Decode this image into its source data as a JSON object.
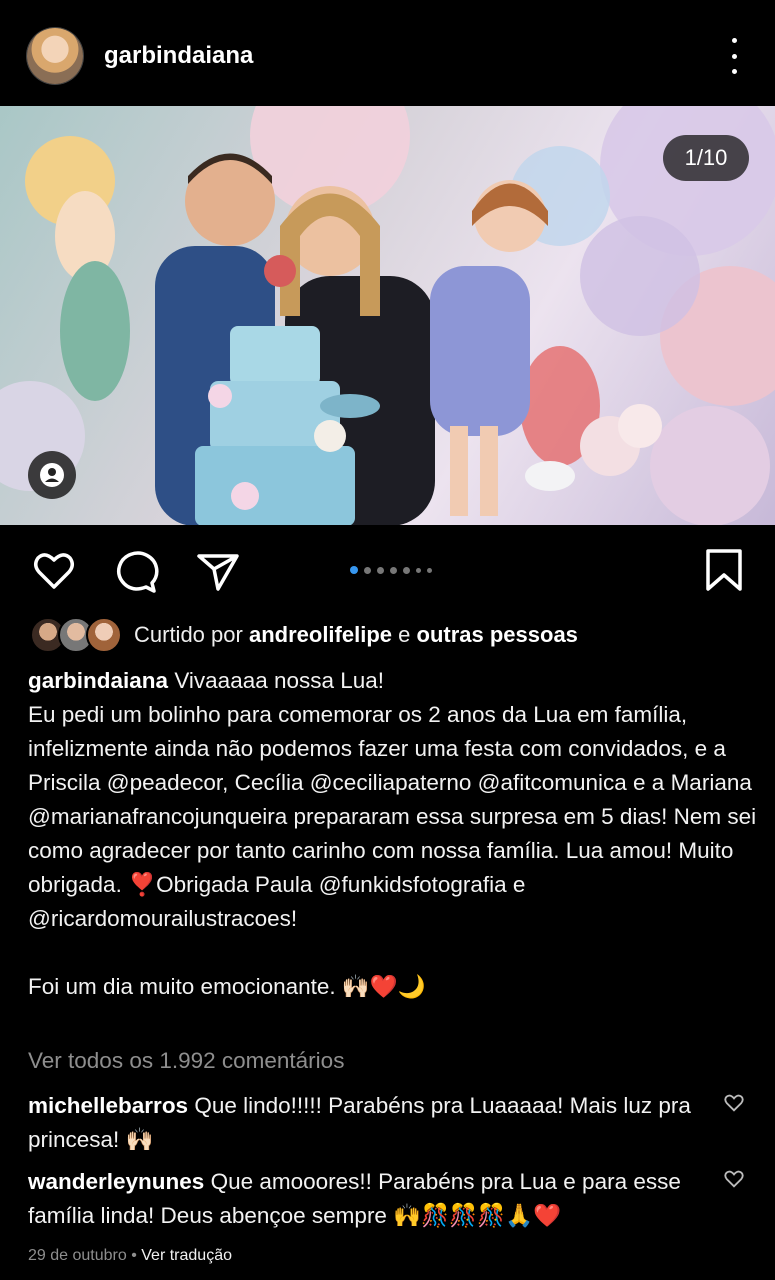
{
  "post": {
    "username": "garbindaiana",
    "counter": "1/10",
    "liked_by_prefix": "Curtido por",
    "liked_by_user": "andreolifelipe",
    "liked_by_connector": "e",
    "liked_by_others": "outras pessoas",
    "caption_user": "garbindaiana",
    "caption_text": "Vivaaaaa nossa Lua!\nEu pedi um bolinho para comemorar os 2 anos da Lua em família, infelizmente ainda não podemos fazer uma festa com convidados, e a Priscila @peadecor, Cecília @ceciliapaterno @afitcomunica e a Mariana @marianafrancojunqueira prepararam essa surpresa em 5 dias! Nem sei como agradecer por tanto carinho com nossa família. Lua amou! Muito obrigada. ❣️Obrigada Paula @funkidsfotografia e @ricardomourailustracoes!\n\nFoi um dia muito emocionante. 🙌🏻❤️🌙",
    "view_all_comments": "Ver todos os 1.992 comentários",
    "comments": [
      {
        "user": "michellebarros",
        "text": "Que lindo!!!!! Parabéns pra Luaaaaa! Mais luz pra princesa! 🙌🏻"
      },
      {
        "user": "wanderleynunes",
        "text": "Que amooores!! Parabéns pra Lua e para esse família linda! Deus abençoe sempre 🙌🎊🎊🎊🙏❤️"
      }
    ],
    "date": "29 de outubro",
    "separator": "•",
    "translate": "Ver tradução",
    "carousel": {
      "current": 1,
      "total": 10
    }
  },
  "icons": {
    "more": "more-vertical-icon",
    "like": "heart-icon",
    "comment": "comment-icon",
    "share": "send-icon",
    "save": "bookmark-icon",
    "tag": "user-tag-icon"
  },
  "colors": {
    "background": "#000000",
    "active_dot": "#3797f0",
    "secondary_text": "#8e8e8e"
  }
}
